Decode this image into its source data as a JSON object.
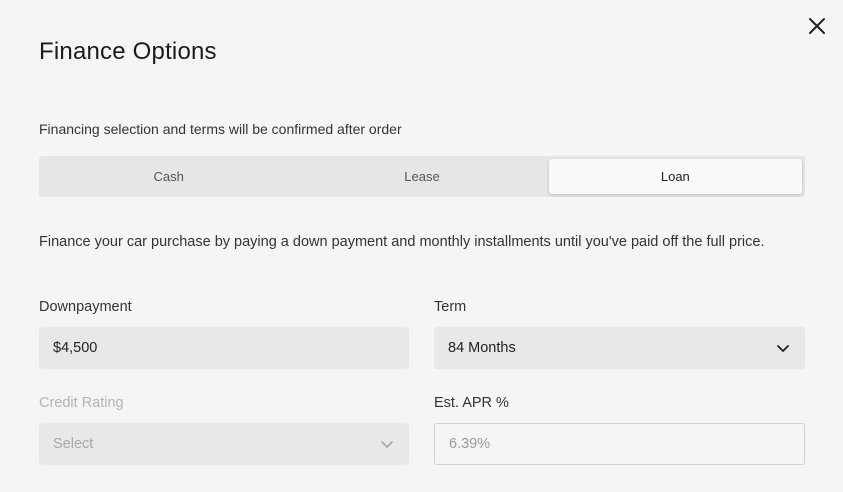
{
  "modal": {
    "title": "Finance Options",
    "close_icon": "close-icon",
    "subtitle": "Financing selection and terms will be confirmed after order"
  },
  "tabs": [
    {
      "label": "Cash",
      "active": false
    },
    {
      "label": "Lease",
      "active": false
    },
    {
      "label": "Loan",
      "active": true
    }
  ],
  "description": "Finance your car purchase by paying a down payment and monthly installments until you've paid off the full price.",
  "fields": {
    "downpayment": {
      "label": "Downpayment",
      "value": "$4,500"
    },
    "term": {
      "label": "Term",
      "value": "84 Months",
      "icon": "chevron-down-icon"
    },
    "credit_rating": {
      "label": "Credit Rating",
      "value": "Select",
      "icon": "chevron-down-icon"
    },
    "apr": {
      "label": "Est. APR %",
      "value": "6.39%"
    }
  },
  "colors": {
    "background": "#f5f5f5",
    "field_background": "#e8e8e8",
    "tab_track": "#e6e6e6",
    "tab_active": "#fafafa"
  }
}
